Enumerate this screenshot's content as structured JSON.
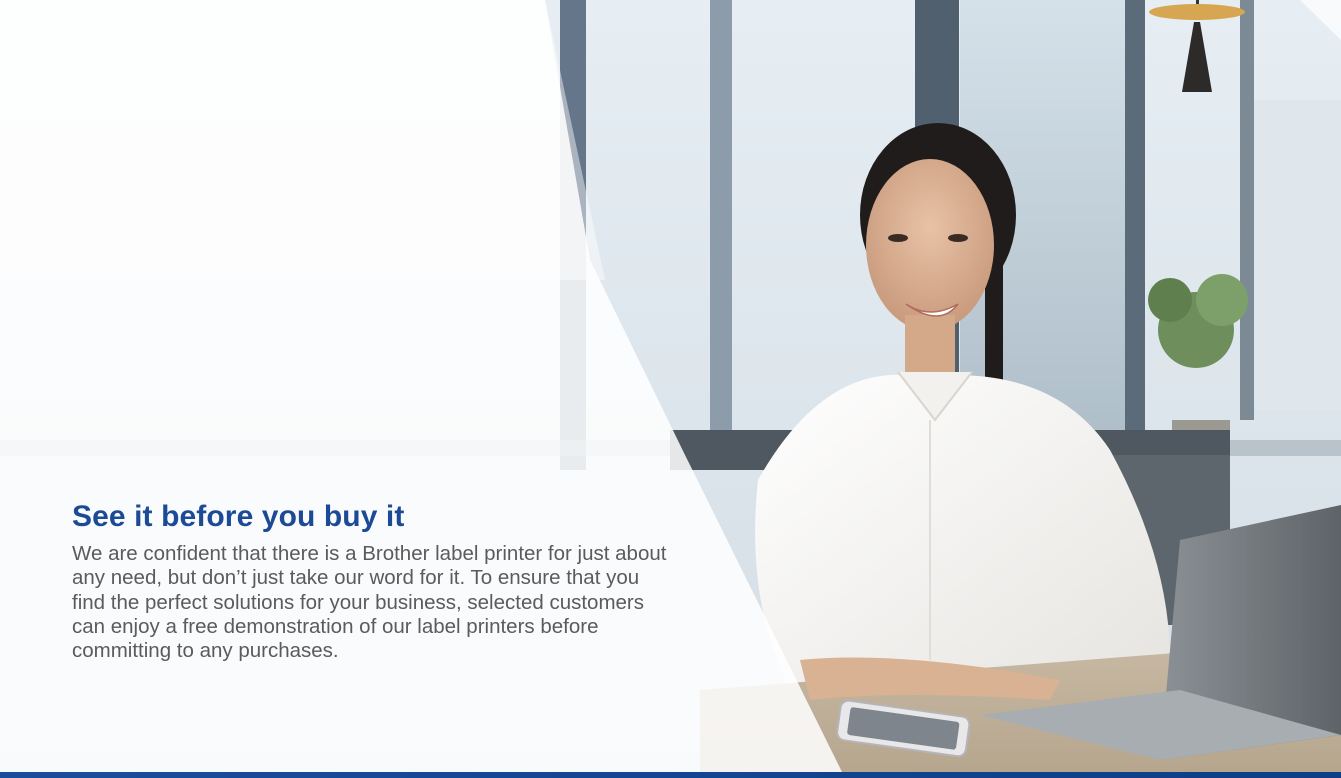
{
  "promo": {
    "title": "See it before you buy it",
    "body": "We are confident that there is a Brother label printer for just about any need, but don’t just take our word for it. To ensure that you find the perfect solutions for your business, selected customers can enjoy a free demonstration of our label printers before committing to any purchases."
  },
  "colors": {
    "title_blue": "#1c4a96",
    "body_gray": "#5b5b5b",
    "band_blue": "#1a4d9c"
  }
}
